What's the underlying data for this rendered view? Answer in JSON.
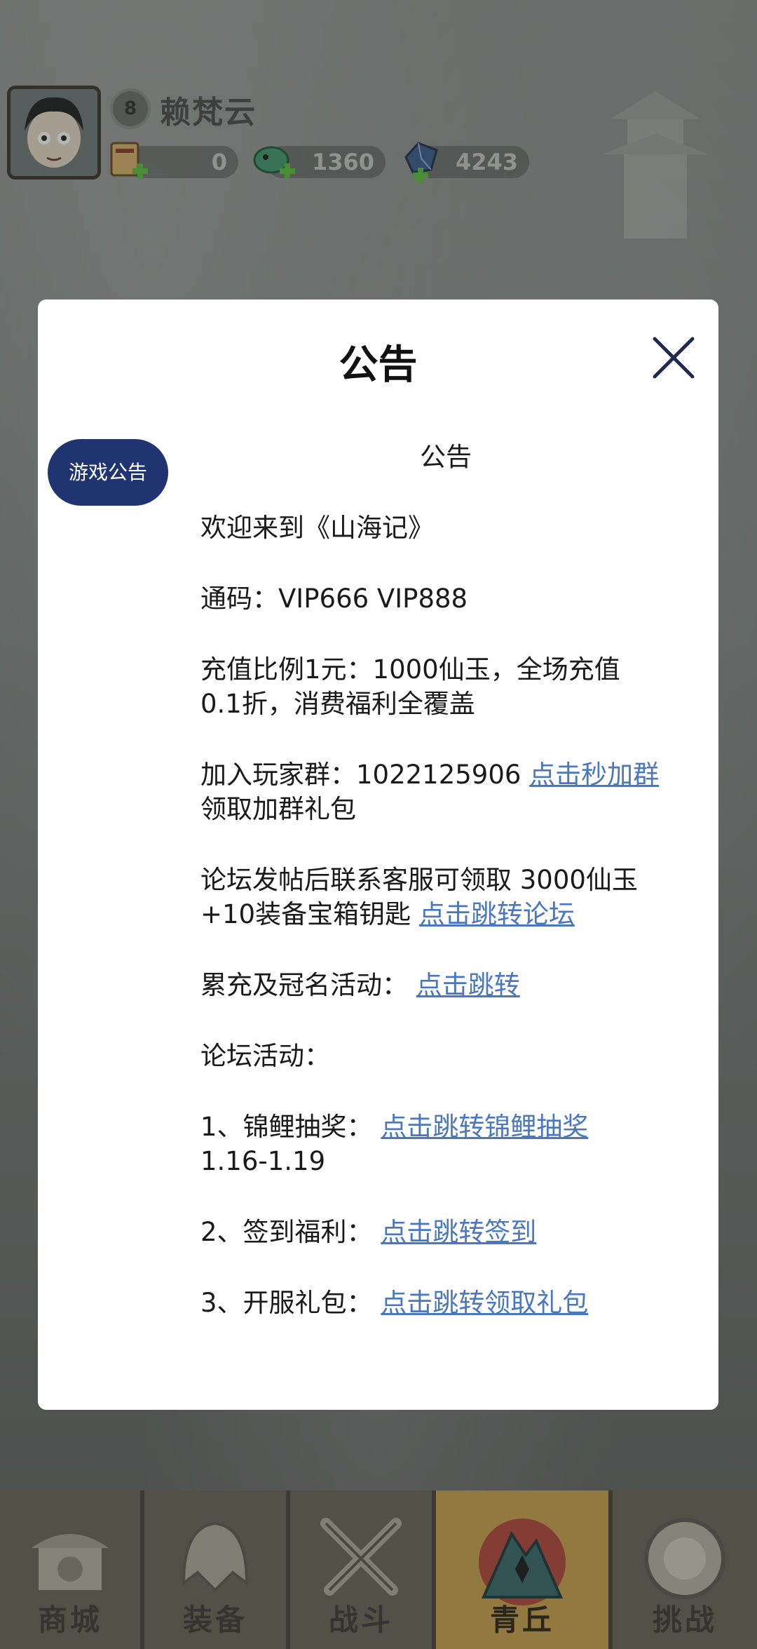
{
  "player": {
    "level": "8",
    "name": "赖梵云",
    "currencies": [
      {
        "icon": "scroll-token-icon",
        "value": "0"
      },
      {
        "icon": "jade-dragon-icon",
        "value": "1360"
      },
      {
        "icon": "blue-crystal-icon",
        "value": "4243"
      }
    ]
  },
  "modal": {
    "title": "公告",
    "tab_label": "游戏公告",
    "heading": "公告",
    "welcome": "欢迎来到《山海记》",
    "codes": "通码：VIP666 VIP888",
    "recharge_line1": "充值比例1元：1000仙玉，全场充值",
    "recharge_line2": "0.1折，消费福利全覆盖",
    "group_text": "加入玩家群：1022125906 ",
    "group_link": "点击秒加群",
    "group_text2": "领取加群礼包",
    "forum_line1": "论坛发帖后联系客服可领取 3000仙玉",
    "forum_text2": "+10装备宝箱钥匙 ",
    "forum_link": "点击跳转论坛",
    "accum_text": "累充及冠名活动：",
    "accum_link": "点击跳转",
    "forum_activity": "论坛活动：",
    "item1_text": "1、锦鲤抽奖：",
    "item1_link": "点击跳转锦鲤抽奖",
    "item1_date": "1.16-1.19",
    "item2_text": "2、签到福利：",
    "item2_link": "点击跳转签到",
    "item3_text": "3、开服礼包：",
    "item3_link": "点击跳转领取礼包"
  },
  "nav": [
    {
      "label": "商城",
      "icon": "shop-icon"
    },
    {
      "label": "装备",
      "icon": "helmet-icon"
    },
    {
      "label": "战斗",
      "icon": "crossed-swords-icon"
    },
    {
      "label": "青丘",
      "icon": "mountain-emblem-icon"
    },
    {
      "label": "挑战",
      "icon": "orb-icon"
    }
  ],
  "colors": {
    "link": "#4a78c0",
    "tab": "#1f3470",
    "active_nav": "#c9a34a"
  }
}
